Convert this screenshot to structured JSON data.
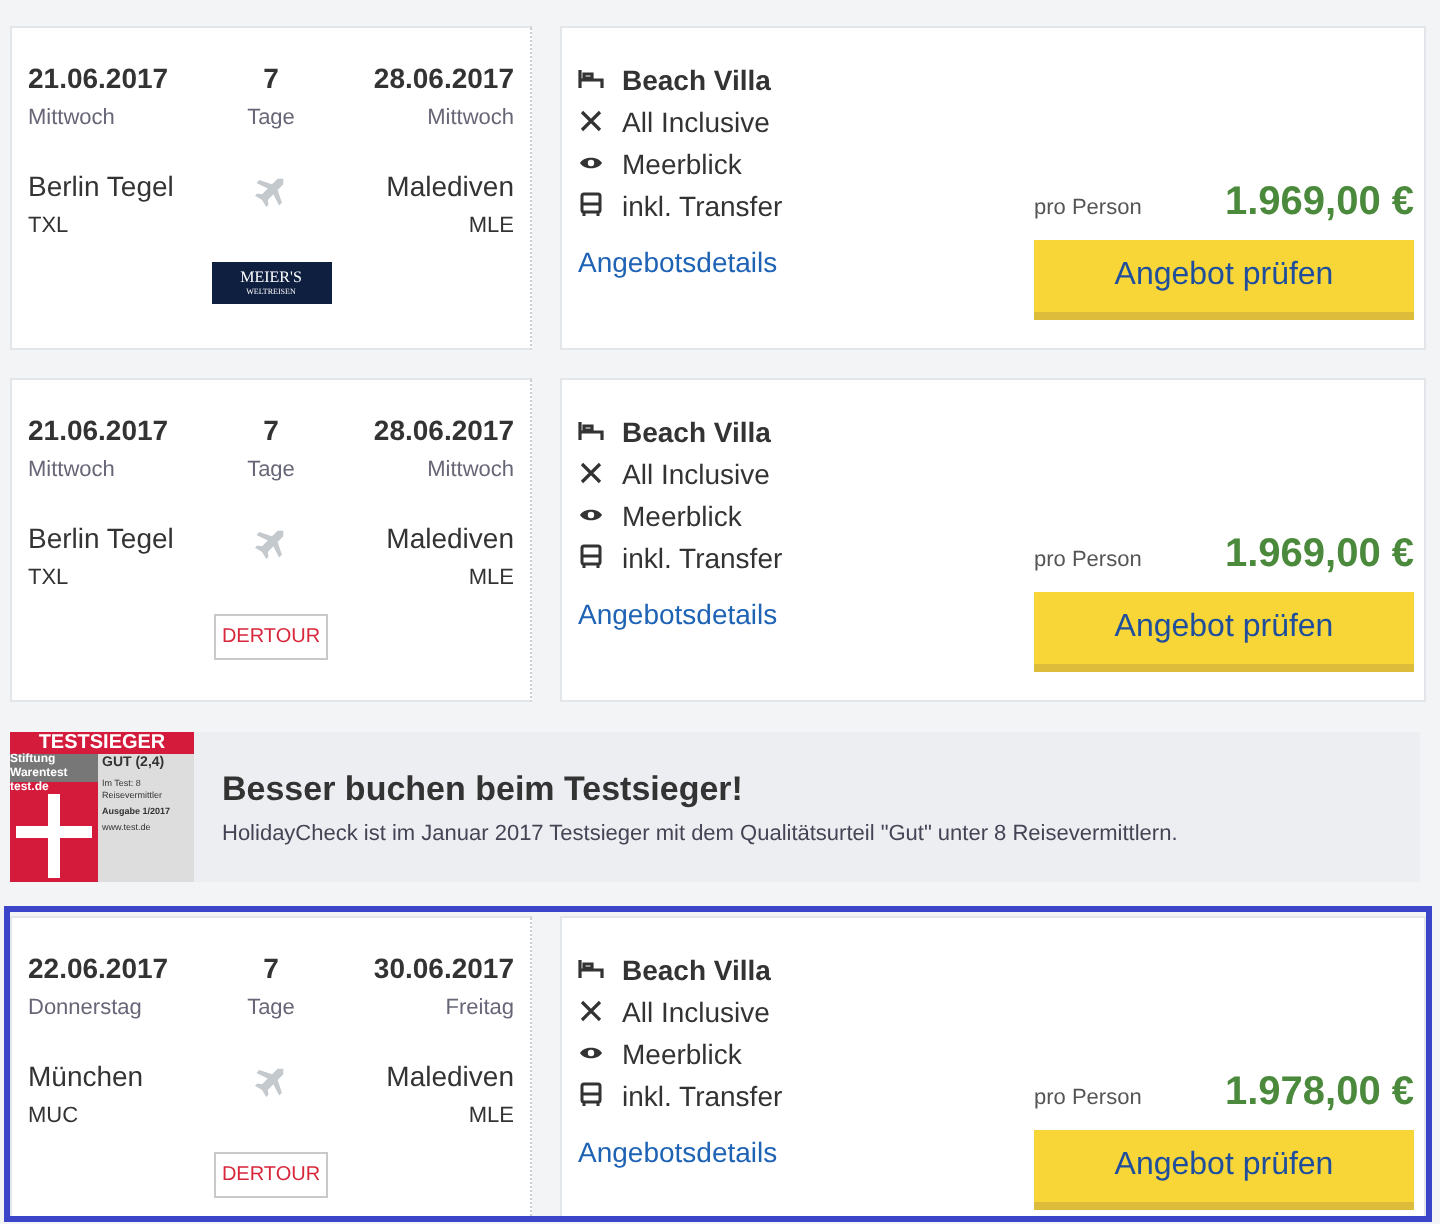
{
  "offers": [
    {
      "selected": false,
      "depart_date": "21.06.2017",
      "depart_day": "Mittwoch",
      "nights": "7",
      "nights_label": "Tage",
      "return_date": "28.06.2017",
      "return_day": "Mittwoch",
      "from_city": "Berlin Tegel",
      "from_code": "TXL",
      "to_city": "Malediven",
      "to_code": "MLE",
      "operator": {
        "kind": "meiers",
        "name": "MEIER'S",
        "sub": "WELTREISEN"
      },
      "features": [
        {
          "kind": "room",
          "text": "Beach Villa"
        },
        {
          "kind": "board",
          "text": "All Inclusive"
        },
        {
          "kind": "view",
          "text": "Meerblick"
        },
        {
          "kind": "transfer",
          "text": "inkl. Transfer"
        }
      ],
      "details_link": "Angebotsdetails",
      "price_note": "pro Person",
      "price": "1.969,00 €",
      "button": "Angebot prüfen"
    },
    {
      "selected": false,
      "depart_date": "21.06.2017",
      "depart_day": "Mittwoch",
      "nights": "7",
      "nights_label": "Tage",
      "return_date": "28.06.2017",
      "return_day": "Mittwoch",
      "from_city": "Berlin Tegel",
      "from_code": "TXL",
      "to_city": "Malediven",
      "to_code": "MLE",
      "operator": {
        "kind": "dertour",
        "name": "DERTOUR"
      },
      "features": [
        {
          "kind": "room",
          "text": "Beach Villa"
        },
        {
          "kind": "board",
          "text": "All Inclusive"
        },
        {
          "kind": "view",
          "text": "Meerblick"
        },
        {
          "kind": "transfer",
          "text": "inkl. Transfer"
        }
      ],
      "details_link": "Angebotsdetails",
      "price_note": "pro Person",
      "price": "1.969,00 €",
      "button": "Angebot prüfen"
    },
    {
      "kind": "banner",
      "badge": {
        "top": "TESTSIEGER",
        "org": "Stiftung Warentest",
        "grade": "GUT (2,4)",
        "site": "test.de",
        "test": "Im Test: 8 Reisevermittler",
        "issue": "Ausgabe 1/2017",
        "url": "www.test.de"
      },
      "title": "Besser buchen beim Testsieger!",
      "text": "HolidayCheck ist im Januar 2017 Testsieger mit dem Qualitätsurteil \"Gut\" unter 8 Reisevermittlern."
    },
    {
      "selected": true,
      "depart_date": "22.06.2017",
      "depart_day": "Donnerstag",
      "nights": "7",
      "nights_label": "Tage",
      "return_date": "30.06.2017",
      "return_day": "Freitag",
      "from_city": "München",
      "from_code": "MUC",
      "to_city": "Malediven",
      "to_code": "MLE",
      "operator": {
        "kind": "dertour",
        "name": "DERTOUR"
      },
      "features": [
        {
          "kind": "room",
          "text": "Beach Villa"
        },
        {
          "kind": "board",
          "text": "All Inclusive"
        },
        {
          "kind": "view",
          "text": "Meerblick"
        },
        {
          "kind": "transfer",
          "text": "inkl. Transfer"
        }
      ],
      "details_link": "Angebotsdetails",
      "price_note": "pro Person",
      "price": "1.978,00 €",
      "button": "Angebot prüfen"
    }
  ]
}
